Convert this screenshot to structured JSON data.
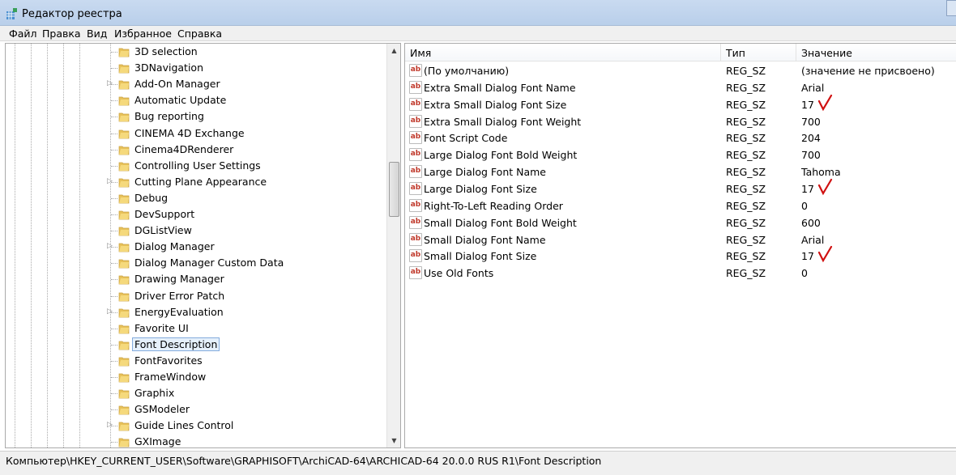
{
  "window": {
    "title": "Редактор реестра"
  },
  "menu": [
    "Файл",
    "Правка",
    "Вид",
    "Избранное",
    "Справка"
  ],
  "tree": [
    {
      "label": "3D selection",
      "expandable": false
    },
    {
      "label": "3DNavigation",
      "expandable": false
    },
    {
      "label": "Add-On Manager",
      "expandable": true
    },
    {
      "label": "Automatic Update",
      "expandable": false
    },
    {
      "label": "Bug reporting",
      "expandable": false
    },
    {
      "label": "CINEMA 4D Exchange",
      "expandable": false
    },
    {
      "label": "Cinema4DRenderer",
      "expandable": false
    },
    {
      "label": "Controlling User Settings",
      "expandable": false
    },
    {
      "label": "Cutting Plane Appearance",
      "expandable": true
    },
    {
      "label": "Debug",
      "expandable": false
    },
    {
      "label": "DevSupport",
      "expandable": false
    },
    {
      "label": "DGListView",
      "expandable": false
    },
    {
      "label": "Dialog Manager",
      "expandable": true
    },
    {
      "label": "Dialog Manager Custom Data",
      "expandable": false
    },
    {
      "label": "Drawing Manager",
      "expandable": false
    },
    {
      "label": "Driver Error Patch",
      "expandable": false
    },
    {
      "label": "EnergyEvaluation",
      "expandable": true
    },
    {
      "label": "Favorite UI",
      "expandable": false
    },
    {
      "label": "Font Description",
      "expandable": false,
      "selected": true
    },
    {
      "label": "FontFavorites",
      "expandable": false
    },
    {
      "label": "FrameWindow",
      "expandable": false
    },
    {
      "label": "Graphix",
      "expandable": false
    },
    {
      "label": "GSModeler",
      "expandable": false
    },
    {
      "label": "Guide Lines Control",
      "expandable": true
    },
    {
      "label": "GXImage",
      "expandable": false
    }
  ],
  "list": {
    "headers": {
      "name": "Имя",
      "type": "Тип",
      "value": "Значение"
    },
    "rows": [
      {
        "name": "(По умолчанию)",
        "type": "REG_SZ",
        "value": "(значение не присвоено)",
        "checked": false
      },
      {
        "name": "Extra Small Dialog Font Name",
        "type": "REG_SZ",
        "value": "Arial",
        "checked": false
      },
      {
        "name": "Extra Small Dialog Font Size",
        "type": "REG_SZ",
        "value": "17",
        "checked": true
      },
      {
        "name": "Extra Small Dialog Font Weight",
        "type": "REG_SZ",
        "value": "700",
        "checked": false
      },
      {
        "name": "Font Script Code",
        "type": "REG_SZ",
        "value": "204",
        "checked": false
      },
      {
        "name": "Large Dialog Font Bold Weight",
        "type": "REG_SZ",
        "value": "700",
        "checked": false
      },
      {
        "name": "Large Dialog Font Name",
        "type": "REG_SZ",
        "value": "Tahoma",
        "checked": false
      },
      {
        "name": "Large Dialog Font Size",
        "type": "REG_SZ",
        "value": "17",
        "checked": true
      },
      {
        "name": "Right-To-Left Reading Order",
        "type": "REG_SZ",
        "value": "0",
        "checked": false
      },
      {
        "name": "Small Dialog Font Bold Weight",
        "type": "REG_SZ",
        "value": "600",
        "checked": false
      },
      {
        "name": "Small Dialog Font Name",
        "type": "REG_SZ",
        "value": "Arial",
        "checked": false
      },
      {
        "name": "Small Dialog Font Size",
        "type": "REG_SZ",
        "value": "17",
        "checked": true
      },
      {
        "name": "Use Old Fonts",
        "type": "REG_SZ",
        "value": "0",
        "checked": false
      }
    ]
  },
  "status": {
    "path": "Компьютер\\HKEY_CURRENT_USER\\Software\\GRAPHISOFT\\ArchiCAD-64\\ARCHICAD-64 20.0.0 RUS R1\\Font Description"
  },
  "icons": {
    "app": "registry-editor-icon",
    "folder": "folder-icon",
    "value": "string-value-icon"
  },
  "colors": {
    "check": "#d01010",
    "folder": "#e8c25a",
    "selection": "#e5f0fb"
  }
}
